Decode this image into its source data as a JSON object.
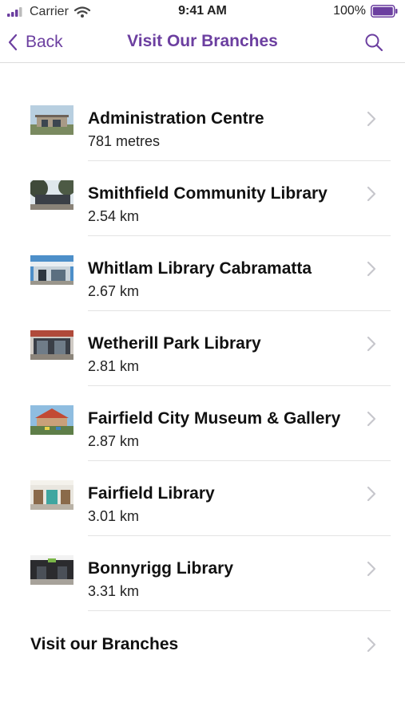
{
  "status_bar": {
    "carrier": "Carrier",
    "time": "9:41 AM",
    "battery_percent": "100%",
    "icons": [
      "signal-bars-icon",
      "wifi-icon",
      "battery-icon"
    ]
  },
  "nav_bar": {
    "back_label": "Back",
    "title": "Visit Our Branches",
    "icons": [
      "chevron-left-icon",
      "search-icon"
    ]
  },
  "colors": {
    "accent": "#6C3FA0",
    "separator": "#E3E3E3",
    "chevron": "#C7C7CC"
  },
  "branches": [
    {
      "name": "Administration Centre",
      "distance": "781 metres",
      "thumbnail": "administration-centre-photo"
    },
    {
      "name": "Smithfield Community Library",
      "distance": "2.54 km",
      "thumbnail": "smithfield-library-photo"
    },
    {
      "name": "Whitlam Library Cabramatta",
      "distance": "2.67 km",
      "thumbnail": "whitlam-library-photo"
    },
    {
      "name": "Wetherill Park Library",
      "distance": "2.81 km",
      "thumbnail": "wetherill-park-library-photo"
    },
    {
      "name": "Fairfield City Museum & Gallery",
      "distance": "2.87 km",
      "thumbnail": "fairfield-museum-photo"
    },
    {
      "name": "Fairfield Library",
      "distance": "3.01 km",
      "thumbnail": "fairfield-library-photo"
    },
    {
      "name": "Bonnyrigg Library",
      "distance": "3.31 km",
      "thumbnail": "bonnyrigg-library-photo"
    }
  ],
  "footer": {
    "label": "Visit our Branches"
  }
}
